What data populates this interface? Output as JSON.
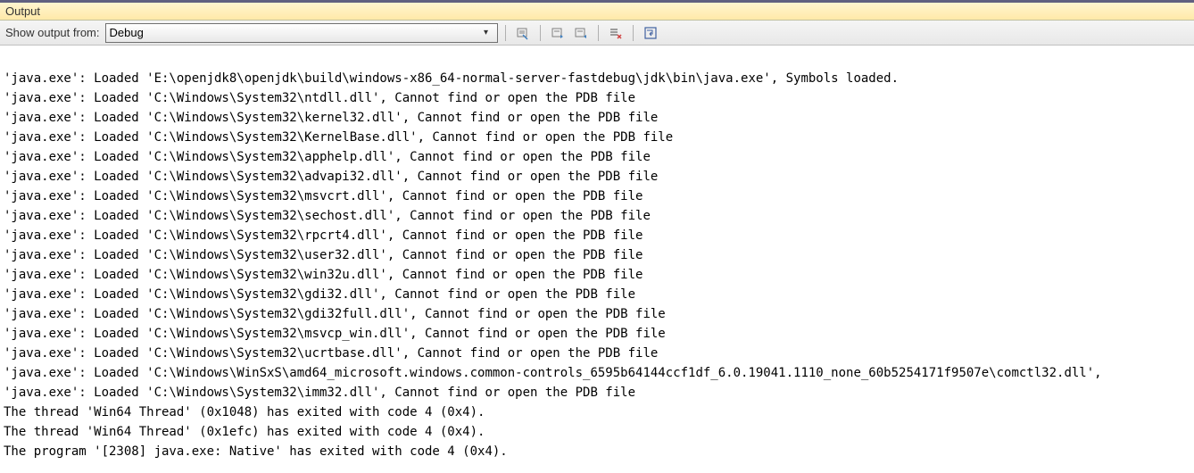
{
  "panel": {
    "title": "Output"
  },
  "toolbar": {
    "show_output_from_label": "Show output from:",
    "dropdown_selected": "Debug"
  },
  "output_lines": [
    "'java.exe': Loaded 'E:\\openjdk8\\openjdk\\build\\windows-x86_64-normal-server-fastdebug\\jdk\\bin\\java.exe', Symbols loaded.",
    "'java.exe': Loaded 'C:\\Windows\\System32\\ntdll.dll', Cannot find or open the PDB file",
    "'java.exe': Loaded 'C:\\Windows\\System32\\kernel32.dll', Cannot find or open the PDB file",
    "'java.exe': Loaded 'C:\\Windows\\System32\\KernelBase.dll', Cannot find or open the PDB file",
    "'java.exe': Loaded 'C:\\Windows\\System32\\apphelp.dll', Cannot find or open the PDB file",
    "'java.exe': Loaded 'C:\\Windows\\System32\\advapi32.dll', Cannot find or open the PDB file",
    "'java.exe': Loaded 'C:\\Windows\\System32\\msvcrt.dll', Cannot find or open the PDB file",
    "'java.exe': Loaded 'C:\\Windows\\System32\\sechost.dll', Cannot find or open the PDB file",
    "'java.exe': Loaded 'C:\\Windows\\System32\\rpcrt4.dll', Cannot find or open the PDB file",
    "'java.exe': Loaded 'C:\\Windows\\System32\\user32.dll', Cannot find or open the PDB file",
    "'java.exe': Loaded 'C:\\Windows\\System32\\win32u.dll', Cannot find or open the PDB file",
    "'java.exe': Loaded 'C:\\Windows\\System32\\gdi32.dll', Cannot find or open the PDB file",
    "'java.exe': Loaded 'C:\\Windows\\System32\\gdi32full.dll', Cannot find or open the PDB file",
    "'java.exe': Loaded 'C:\\Windows\\System32\\msvcp_win.dll', Cannot find or open the PDB file",
    "'java.exe': Loaded 'C:\\Windows\\System32\\ucrtbase.dll', Cannot find or open the PDB file",
    "'java.exe': Loaded 'C:\\Windows\\WinSxS\\amd64_microsoft.windows.common-controls_6595b64144ccf1df_6.0.19041.1110_none_60b5254171f9507e\\comctl32.dll',",
    "'java.exe': Loaded 'C:\\Windows\\System32\\imm32.dll', Cannot find or open the PDB file",
    "The thread 'Win64 Thread' (0x1048) has exited with code 4 (0x4).",
    "The thread 'Win64 Thread' (0x1efc) has exited with code 4 (0x4).",
    "The program '[2308] java.exe: Native' has exited with code 4 (0x4)."
  ]
}
